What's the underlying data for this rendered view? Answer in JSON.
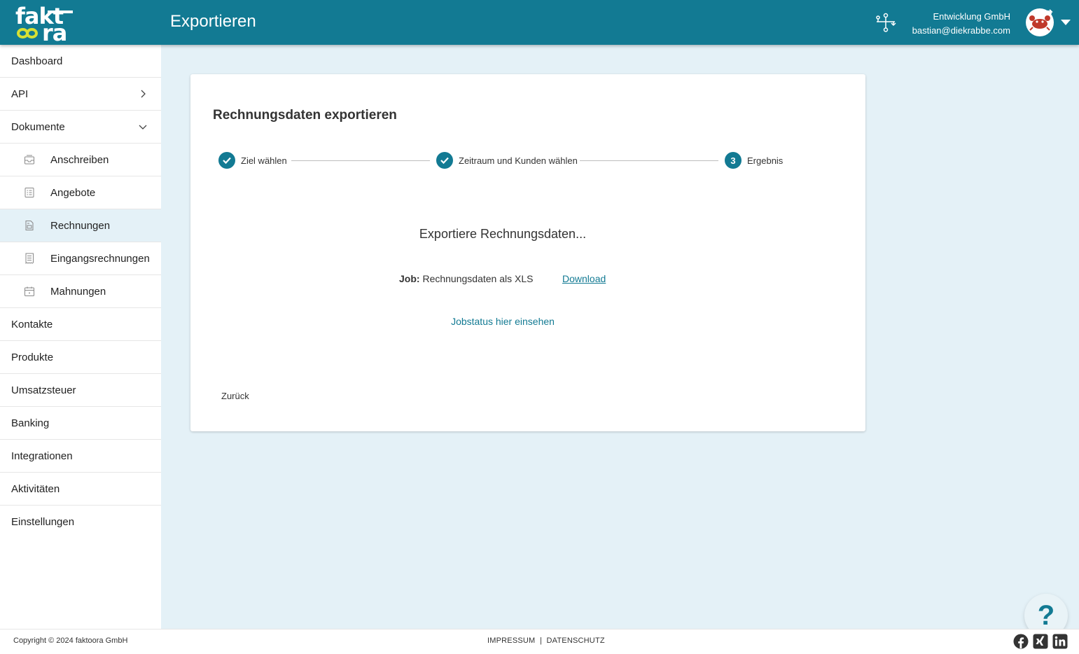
{
  "colors": {
    "primary": "#127a93",
    "accent": "#d7e033",
    "background": "#e4f1f7"
  },
  "logo": {
    "line1": "fakt",
    "line2": "ra"
  },
  "header": {
    "title": "Exportieren",
    "org_icon": "organization-tree-icon",
    "company": "Entwicklung GmbH",
    "email": "bastian@diekrabbe.com"
  },
  "sidebar": {
    "items": [
      {
        "label": "Dashboard"
      },
      {
        "label": "API",
        "icon": "chevron-right-icon"
      },
      {
        "label": "Dokumente",
        "icon": "chevron-down-icon"
      },
      {
        "label": "Anschreiben",
        "icon": "inbox-icon"
      },
      {
        "label": "Angebote",
        "icon": "list-document-icon"
      },
      {
        "label": "Rechnungen",
        "icon": "invoice-icon",
        "active": true
      },
      {
        "label": "Eingangsrechnungen",
        "icon": "receipt-icon"
      },
      {
        "label": "Mahnungen",
        "icon": "calendar-icon"
      },
      {
        "label": "Kontakte"
      },
      {
        "label": "Produkte"
      },
      {
        "label": "Umsatzsteuer"
      },
      {
        "label": "Banking"
      },
      {
        "label": "Integrationen"
      },
      {
        "label": "Aktivitäten"
      },
      {
        "label": "Einstellungen"
      }
    ]
  },
  "card": {
    "title": "Rechnungsdaten exportieren",
    "steps": [
      {
        "label": "Ziel wählen",
        "state": "done"
      },
      {
        "label": "Zeitraum und Kunden wählen",
        "state": "done"
      },
      {
        "label": "Ergebnis",
        "state": "active",
        "number": "3"
      }
    ],
    "export_message": "Exportiere Rechnungsdaten...",
    "job_label": "Job:",
    "job_value": "Rechnungsdaten als XLS",
    "download_label": "Download",
    "jobstatus_label": "Jobstatus hier einsehen",
    "back_label": "Zurück"
  },
  "help": {
    "label": "?"
  },
  "footer": {
    "copyright": "Copyright © 2024 faktoora GmbH",
    "impressum": "IMPRESSUM",
    "separator": "|",
    "datenschutz": "DATENSCHUTZ",
    "social": [
      "facebook-icon",
      "xing-icon",
      "linkedin-icon"
    ]
  }
}
